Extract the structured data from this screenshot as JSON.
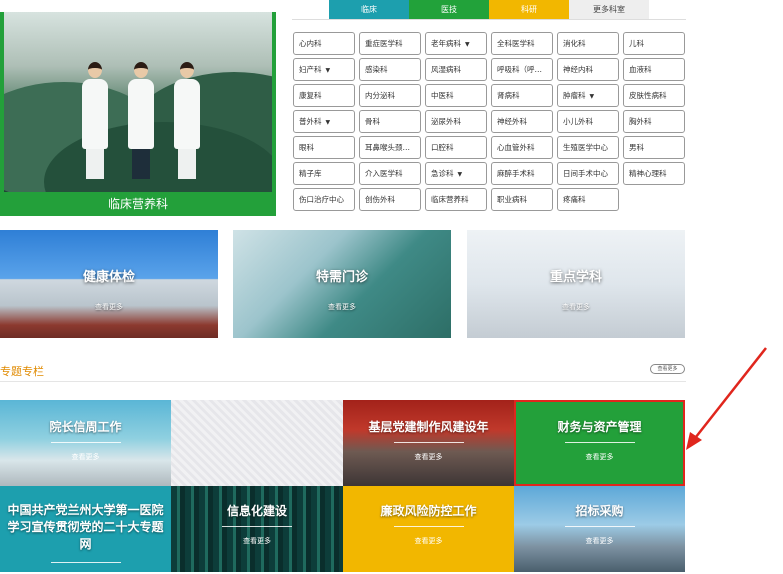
{
  "feature": {
    "caption": "临床营养科"
  },
  "tabs": [
    "临床",
    "医技",
    "科研",
    "更多科室"
  ],
  "departments": [
    {
      "label": "心内科",
      "caret": false
    },
    {
      "label": "重症医学科",
      "caret": false
    },
    {
      "label": "老年病科",
      "caret": true
    },
    {
      "label": "全科医学科",
      "caret": false
    },
    {
      "label": "消化科",
      "caret": false
    },
    {
      "label": "儿科",
      "caret": false
    },
    {
      "label": "妇产科",
      "caret": true
    },
    {
      "label": "感染科",
      "caret": false
    },
    {
      "label": "风湿病科",
      "caret": false
    },
    {
      "label": "呼吸科（呼…",
      "caret": false
    },
    {
      "label": "神经内科",
      "caret": false
    },
    {
      "label": "血液科",
      "caret": false
    },
    {
      "label": "康复科",
      "caret": false
    },
    {
      "label": "内分泌科",
      "caret": false
    },
    {
      "label": "中医科",
      "caret": false
    },
    {
      "label": "肾病科",
      "caret": false
    },
    {
      "label": "肿瘤科",
      "caret": true
    },
    {
      "label": "皮肤性病科",
      "caret": false
    },
    {
      "label": "普外科",
      "caret": true
    },
    {
      "label": "骨科",
      "caret": false
    },
    {
      "label": "泌尿外科",
      "caret": false
    },
    {
      "label": "神经外科",
      "caret": false
    },
    {
      "label": "小儿外科",
      "caret": false
    },
    {
      "label": "胸外科",
      "caret": false
    },
    {
      "label": "眼科",
      "caret": false
    },
    {
      "label": "耳鼻喉头颈…",
      "caret": false
    },
    {
      "label": "口腔科",
      "caret": false
    },
    {
      "label": "心血管外科",
      "caret": false
    },
    {
      "label": "生殖医学中心",
      "caret": false
    },
    {
      "label": "男科",
      "caret": false
    },
    {
      "label": "精子库",
      "caret": false
    },
    {
      "label": "介入医学科",
      "caret": false
    },
    {
      "label": "急诊科",
      "caret": true
    },
    {
      "label": "麻醉手术科",
      "caret": false
    },
    {
      "label": "日间手术中心",
      "caret": false
    },
    {
      "label": "精神心理科",
      "caret": false
    },
    {
      "label": "伤口治疗中心",
      "caret": false
    },
    {
      "label": "创伤外科",
      "caret": false
    },
    {
      "label": "临床营养科",
      "caret": false
    },
    {
      "label": "职业病科",
      "caret": false
    },
    {
      "label": "疼痛科",
      "caret": false
    }
  ],
  "banners": [
    {
      "title": "健康体检",
      "more": "查看更多"
    },
    {
      "title": "特需门诊",
      "more": "查看更多"
    },
    {
      "title": "重点学科",
      "more": "查看更多"
    }
  ],
  "section": {
    "title": "专题专栏",
    "more": "查看更多"
  },
  "tiles": [
    {
      "title": "院长信周工作",
      "more": "查看更多"
    },
    {
      "title": "",
      "more": ""
    },
    {
      "title": "基层党建制作风建设年",
      "more": "查看更多"
    },
    {
      "title": "财务与资产管理",
      "more": "查看更多"
    },
    {
      "title": "中国共产党兰州大学第一医院学习宣传贯彻党的二十大专题网",
      "more": ""
    },
    {
      "title": "信息化建设",
      "more": "查看更多"
    },
    {
      "title": "廉政风险防控工作",
      "more": "查看更多"
    },
    {
      "title": "招标采购",
      "more": "查看更多"
    }
  ],
  "colors": {
    "green": "#23a03a",
    "teal": "#1d9fae",
    "yellow": "#f2b700",
    "orange": "#e08a00",
    "red": "#e0261d"
  }
}
